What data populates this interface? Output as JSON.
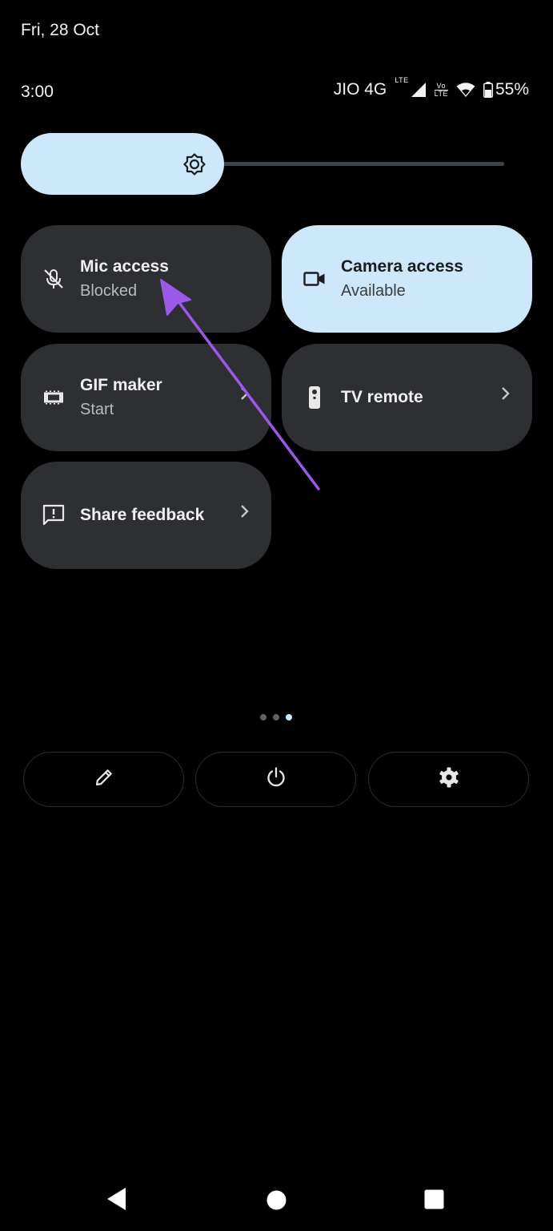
{
  "status_bar": {
    "date": "Fri, 28 Oct",
    "time": "3:00",
    "carrier": "JIO 4G",
    "lte_label": "LTE",
    "volte_label_top": "Vo",
    "volte_label_bottom": "LTE",
    "battery": "55%"
  },
  "brightness": {
    "level_fraction": 0.41,
    "icon": "brightness-icon"
  },
  "tiles": [
    {
      "title": "Mic access",
      "subtitle": "Blocked",
      "icon": "mic-off-icon",
      "active": false
    },
    {
      "title": "Camera access",
      "subtitle": "Available",
      "icon": "camera-icon",
      "active": true
    },
    {
      "title": "GIF maker",
      "subtitle": "Start",
      "icon": "gif-icon",
      "active": false
    },
    {
      "title": "TV remote",
      "subtitle": "",
      "icon": "tv-remote-icon",
      "active": false
    },
    {
      "title": "Share feedback",
      "subtitle": "",
      "icon": "feedback-icon",
      "active": false
    }
  ],
  "page_indicator": {
    "pages": 3,
    "current": 3
  },
  "bottom_buttons": [
    "edit-icon",
    "power-icon",
    "settings-icon"
  ],
  "nav_bar": [
    "back-icon",
    "home-icon",
    "recents-icon"
  ],
  "colors": {
    "accent": "#cde8fa",
    "tile_bg": "#2d2f32",
    "annotation_arrow": "#9b59e8"
  }
}
